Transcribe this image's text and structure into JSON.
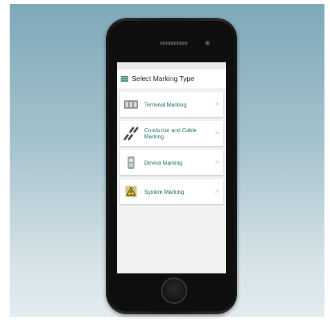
{
  "app": {
    "title": "Select Marking Type"
  },
  "icons": {
    "menu": "hamburger-menu-icon",
    "chevron": "chevron-right-icon"
  },
  "colors": {
    "accent": "#3a8a5a",
    "item_text": "#1f6e6a",
    "background_top": "#7fa9b9",
    "background_bottom": "#e3ecef"
  },
  "items": [
    {
      "label": "Terminal Marking",
      "icon": "terminal-block-icon",
      "chevron": ">"
    },
    {
      "label": "Conductor and Cable Marking",
      "icon": "cable-marker-icon",
      "chevron": ">"
    },
    {
      "label": "Device Marking",
      "icon": "device-label-icon",
      "chevron": ">"
    },
    {
      "label": "System Marking",
      "icon": "warning-sign-icon",
      "chevron": ">"
    }
  ]
}
